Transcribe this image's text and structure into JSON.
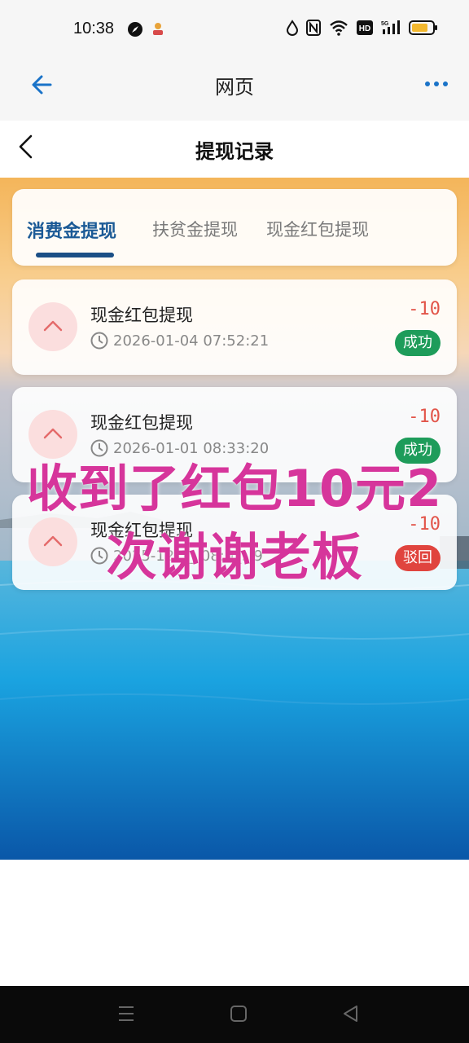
{
  "status_bar": {
    "time": "10:38",
    "left_icons": [
      "compass-icon",
      "app-icon"
    ],
    "right_icons": [
      "drop-icon",
      "nfc-icon",
      "wifi-icon",
      "hd-icon",
      "signal-5g-icon",
      "battery-icon"
    ]
  },
  "browser": {
    "title": "网页",
    "back_icon": "arrow-left-icon",
    "menu_icon": "more-dots-icon"
  },
  "page": {
    "title": "提现记录",
    "back_icon": "chevron-left-icon"
  },
  "tabs": [
    {
      "label": "消费金提现",
      "active": true
    },
    {
      "label": "扶贫金提现",
      "active": false
    },
    {
      "label": "现金红包提现",
      "active": false
    }
  ],
  "records": [
    {
      "title": "现金红包提现",
      "time": "2026-01-04 07:52:21",
      "amount": "-10",
      "status": "成功"
    },
    {
      "title": "现金红包提现",
      "time": "2026-01-01 08:33:20",
      "amount": "-10",
      "status": "成功"
    },
    {
      "title": "现金红包提现",
      "time": "2025-12-1_ 08:0_:_9",
      "amount": "-10",
      "status": "驳回"
    }
  ],
  "overlay": {
    "line1": "收到了红包10元2",
    "line2": "次谢谢老板"
  },
  "colors": {
    "accent": "#1b5a96",
    "amount": "#e2554a",
    "success": "#1e9c5a",
    "rejected": "#e0443e",
    "overlay": "#d6359b"
  },
  "nav": [
    "menu-icon",
    "home-square-icon",
    "back-triangle-icon"
  ]
}
